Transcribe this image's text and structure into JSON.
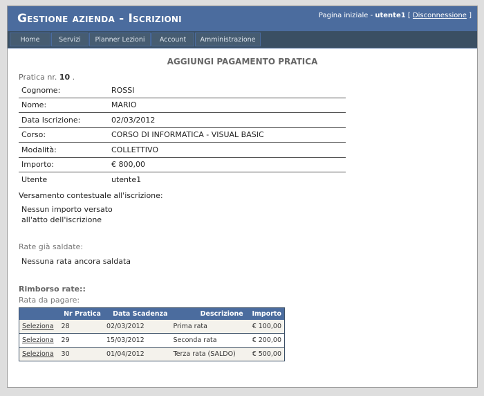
{
  "header": {
    "title_part1": "Gestione azienda",
    "title_sep": " - ",
    "title_part2": "Iscrizioni",
    "home_link": "Pagina iniziale",
    "sep1": " - ",
    "username": "utente1",
    "bracket_open": " [ ",
    "logout_link": "Disconnessione",
    "bracket_close": " ]"
  },
  "nav": {
    "items": [
      {
        "label": "Home"
      },
      {
        "label": "Servizi"
      },
      {
        "label": "Planner Lezioni"
      },
      {
        "label": "Account"
      },
      {
        "label": "Amministrazione"
      }
    ]
  },
  "main": {
    "page_title": "AGGIUNGI PAGAMENTO PRATICA",
    "pratica_prefix": "Pratica nr.",
    "pratica_number": "10",
    "pratica_suffix": ".",
    "details": [
      {
        "label": "Cognome:",
        "value": "ROSSI"
      },
      {
        "label": "Nome:",
        "value": "MARIO"
      },
      {
        "label": "Data Iscrizione:",
        "value": "02/03/2012"
      },
      {
        "label": "Corso:",
        "value": "CORSO DI INFORMATICA - VISUAL BASIC"
      },
      {
        "label": "Modalità:",
        "value": "COLLETTIVO"
      },
      {
        "label": "Importo:",
        "value": "€ 800,00"
      },
      {
        "label": "Utente",
        "value": "utente1"
      }
    ],
    "versamento_label": "Versamento contestuale all'iscrizione:",
    "versamento_text": "Nessun importo versato all'atto dell'iscrizione",
    "rate_saldate_label": "Rate già saldate:",
    "nessuna_rata": "Nessuna rata ancora saldata",
    "rimborso_label": "Rimborso rate::",
    "rata_pagare_label": "Rata da pagare:"
  },
  "grid": {
    "columns": [
      "",
      "Nr Pratica",
      "Data Scadenza",
      "Descrizione",
      "Importo"
    ],
    "rows": [
      {
        "action": "Seleziona",
        "nr": "28",
        "scadenza": "02/03/2012",
        "descrizione": "Prima rata",
        "importo": "€ 100,00"
      },
      {
        "action": "Seleziona",
        "nr": "29",
        "scadenza": "15/03/2012",
        "descrizione": "Seconda rata",
        "importo": "€ 200,00"
      },
      {
        "action": "Seleziona",
        "nr": "30",
        "scadenza": "01/04/2012",
        "descrizione": "Terza rata (SALDO)",
        "importo": "€ 500,00"
      }
    ]
  },
  "colors": {
    "header_bg": "#4b6c9e",
    "nav_bg": "#3a4f63",
    "grid_header_bg": "#4b6c9e"
  }
}
